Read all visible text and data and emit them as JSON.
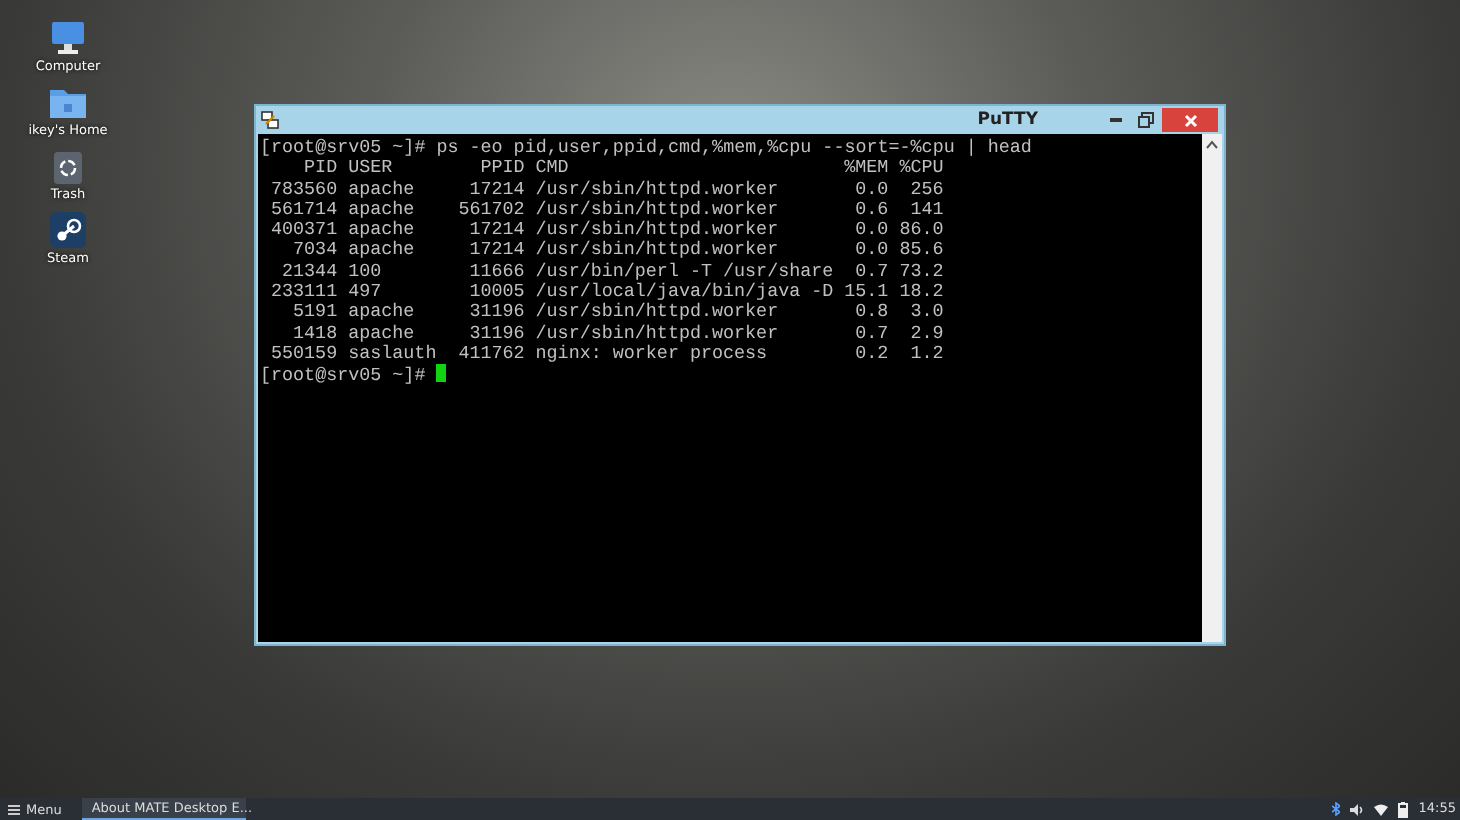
{
  "desktop_icons": [
    {
      "label": "Computer",
      "kind": "computer"
    },
    {
      "label": "ikey's Home",
      "kind": "folder"
    },
    {
      "label": "Trash",
      "kind": "trash"
    },
    {
      "label": "Steam",
      "kind": "steam"
    }
  ],
  "window": {
    "title": "PuTTY",
    "terminal": {
      "command_line": "[root@srv05 ~]# ps -eo pid,user,ppid,cmd,%mem,%cpu --sort=-%cpu | head",
      "columns": [
        "PID",
        "USER",
        "PPID",
        "CMD",
        "%MEM",
        "%CPU"
      ],
      "rows": [
        [
          "783560",
          "apache",
          "17214",
          "/usr/sbin/httpd.worker",
          "0.0",
          "256"
        ],
        [
          "561714",
          "apache",
          "561702",
          "/usr/sbin/httpd.worker",
          "0.6",
          "141"
        ],
        [
          "400371",
          "apache",
          "17214",
          "/usr/sbin/httpd.worker",
          "0.0",
          "86.0"
        ],
        [
          "7034",
          "apache",
          "17214",
          "/usr/sbin/httpd.worker",
          "0.0",
          "85.6"
        ],
        [
          "21344",
          "100",
          "11666",
          "/usr/bin/perl -T /usr/share",
          "0.7",
          "73.2"
        ],
        [
          "233111",
          "497",
          "10005",
          "/usr/local/java/bin/java -D",
          "15.1",
          "18.2"
        ],
        [
          "5191",
          "apache",
          "31196",
          "/usr/sbin/httpd.worker",
          "0.8",
          "3.0"
        ],
        [
          "1418",
          "apache",
          "31196",
          "/usr/sbin/httpd.worker",
          "0.7",
          "2.9"
        ],
        [
          "550159",
          "saslauth",
          "411762",
          "nginx: worker process",
          "0.2",
          "1.2"
        ]
      ],
      "prompt": "[root@srv05 ~]#"
    }
  },
  "taskbar": {
    "menu": "Menu",
    "tasks": [
      {
        "label": "About MATE Desktop E...",
        "selected": true
      }
    ],
    "clock": "14:55"
  }
}
